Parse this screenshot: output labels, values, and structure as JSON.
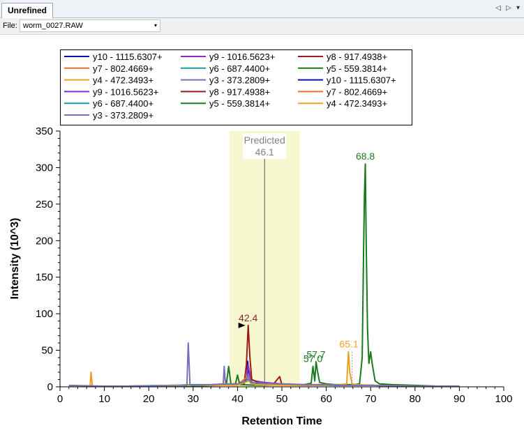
{
  "tab": {
    "label": "Unrefined"
  },
  "tab_controls": {
    "prev": "◁",
    "next": "▷",
    "menu": "▾"
  },
  "file": {
    "label": "File:",
    "value": "worm_0027.RAW",
    "dropdown_glyph": "▾"
  },
  "chart_data": {
    "type": "line",
    "xlabel": "Retention Time",
    "ylabel": "Intensity (10^3)",
    "xlim": [
      0,
      100
    ],
    "ylim": [
      0,
      350
    ],
    "xticks": [
      0,
      10,
      20,
      30,
      40,
      50,
      60,
      70,
      80,
      90,
      100
    ],
    "yticks": [
      0,
      50,
      100,
      150,
      200,
      250,
      300,
      350
    ],
    "legend_position": "top",
    "predicted": {
      "label": "Predicted",
      "value": "46.1",
      "x": 46.1,
      "window": [
        38.2,
        54.0
      ]
    },
    "series": [
      {
        "name": "y10 - 1115.6307+",
        "color": "#0a10a8",
        "points": [
          [
            2,
            1
          ],
          [
            10,
            1
          ],
          [
            20,
            1
          ],
          [
            30,
            2
          ],
          [
            38,
            3
          ],
          [
            41,
            3
          ],
          [
            42.1,
            12
          ],
          [
            42.3,
            35
          ],
          [
            42.6,
            14
          ],
          [
            43.2,
            6
          ],
          [
            45,
            4
          ],
          [
            50,
            3
          ],
          [
            55,
            2
          ],
          [
            60,
            2
          ],
          [
            65,
            2
          ],
          [
            70,
            2
          ],
          [
            80,
            1
          ],
          [
            90,
            1
          ]
        ]
      },
      {
        "name": "y9 - 1016.5623+",
        "color": "#8a2cc8",
        "points": [
          [
            2,
            1
          ],
          [
            15,
            1
          ],
          [
            25,
            2
          ],
          [
            35,
            2
          ],
          [
            40,
            3
          ],
          [
            42.0,
            8
          ],
          [
            42.4,
            30
          ],
          [
            43,
            10
          ],
          [
            44,
            8
          ],
          [
            46,
            6
          ],
          [
            48,
            5
          ],
          [
            50,
            4
          ],
          [
            55,
            3
          ],
          [
            60,
            3
          ],
          [
            65,
            2
          ],
          [
            70,
            2
          ],
          [
            80,
            1
          ],
          [
            90,
            1
          ]
        ]
      },
      {
        "name": "y8 - 917.4938+",
        "color": "#9e1a1a",
        "points": [
          [
            2,
            1
          ],
          [
            20,
            1
          ],
          [
            30,
            2
          ],
          [
            38,
            3
          ],
          [
            41.5,
            4
          ],
          [
            42.0,
            30
          ],
          [
            42.4,
            84
          ],
          [
            42.8,
            40
          ],
          [
            43.2,
            10
          ],
          [
            45,
            5
          ],
          [
            48,
            3
          ],
          [
            49.5,
            14
          ],
          [
            50,
            3
          ],
          [
            55,
            2
          ],
          [
            60,
            2
          ],
          [
            70,
            2
          ],
          [
            80,
            1
          ],
          [
            90,
            1
          ]
        ]
      },
      {
        "name": "y7 - 802.4669+",
        "color": "#e8742a",
        "points": [
          [
            2,
            1
          ],
          [
            20,
            1
          ],
          [
            30,
            2
          ],
          [
            40,
            3
          ],
          [
            42.3,
            14
          ],
          [
            43,
            5
          ],
          [
            50,
            3
          ],
          [
            60,
            2
          ],
          [
            65,
            3
          ],
          [
            70,
            2
          ],
          [
            80,
            1
          ],
          [
            90,
            1
          ]
        ]
      },
      {
        "name": "y6 - 687.4400+",
        "color": "#1a9aa0",
        "points": [
          [
            2,
            1
          ],
          [
            15,
            1
          ],
          [
            25,
            2
          ],
          [
            30,
            3
          ],
          [
            35,
            3
          ],
          [
            40,
            3
          ],
          [
            42.4,
            10
          ],
          [
            44,
            4
          ],
          [
            50,
            3
          ],
          [
            60,
            2
          ],
          [
            70,
            2
          ],
          [
            80,
            1
          ],
          [
            90,
            1
          ]
        ]
      },
      {
        "name": "y5 - 559.3814+",
        "color": "#1a7a1a",
        "points": [
          [
            2,
            1
          ],
          [
            20,
            1
          ],
          [
            30,
            1
          ],
          [
            36,
            2
          ],
          [
            37.5,
            4
          ],
          [
            38.0,
            28
          ],
          [
            38.5,
            4
          ],
          [
            39.5,
            3
          ],
          [
            40.0,
            16
          ],
          [
            40.5,
            3
          ],
          [
            45,
            2
          ],
          [
            52,
            3
          ],
          [
            55,
            3
          ],
          [
            56.6,
            5
          ],
          [
            57.0,
            28
          ],
          [
            57.4,
            8
          ],
          [
            57.7,
            34
          ],
          [
            58.0,
            22
          ],
          [
            58.5,
            6
          ],
          [
            60,
            4
          ],
          [
            62,
            3
          ],
          [
            64,
            3
          ],
          [
            66,
            3
          ],
          [
            67.5,
            4
          ],
          [
            68.1,
            40
          ],
          [
            68.4,
            180
          ],
          [
            68.6,
            262
          ],
          [
            68.8,
            305
          ],
          [
            69.0,
            200
          ],
          [
            69.3,
            80
          ],
          [
            69.6,
            32
          ],
          [
            70.0,
            48
          ],
          [
            70.4,
            30
          ],
          [
            71,
            8
          ],
          [
            72,
            4
          ],
          [
            75,
            3
          ],
          [
            80,
            2
          ],
          [
            85,
            1
          ],
          [
            90,
            1
          ]
        ]
      },
      {
        "name": "y4 - 472.3493+",
        "color": "#f0a020",
        "points": [
          [
            2,
            1
          ],
          [
            6.8,
            1
          ],
          [
            7.0,
            20
          ],
          [
            7.3,
            1
          ],
          [
            10,
            1
          ],
          [
            20,
            1
          ],
          [
            30,
            2
          ],
          [
            40,
            2
          ],
          [
            42.4,
            8
          ],
          [
            44,
            3
          ],
          [
            50,
            2
          ],
          [
            60,
            2
          ],
          [
            63,
            3
          ],
          [
            64.6,
            4
          ],
          [
            65.0,
            48
          ],
          [
            65.3,
            20
          ],
          [
            65.8,
            4
          ],
          [
            67,
            3
          ],
          [
            70,
            2
          ],
          [
            80,
            1
          ],
          [
            90,
            1
          ]
        ]
      },
      {
        "name": "y3 - 373.2809+",
        "color": "#7a70b8",
        "points": [
          [
            2,
            2
          ],
          [
            10,
            1
          ],
          [
            20,
            1
          ],
          [
            27,
            1
          ],
          [
            28.6,
            2
          ],
          [
            28.9,
            60
          ],
          [
            29.3,
            3
          ],
          [
            30,
            2
          ],
          [
            34,
            3
          ],
          [
            36.8,
            4
          ],
          [
            37.0,
            28
          ],
          [
            37.3,
            4
          ],
          [
            40,
            4
          ],
          [
            42.0,
            8
          ],
          [
            42.4,
            18
          ],
          [
            43,
            6
          ],
          [
            45,
            5
          ],
          [
            50,
            4
          ],
          [
            55,
            3
          ],
          [
            60,
            3
          ],
          [
            65,
            2
          ],
          [
            70,
            2
          ],
          [
            80,
            1
          ],
          [
            90,
            1
          ]
        ]
      }
    ],
    "annotations": [
      {
        "text": "42.4",
        "x": 42.4,
        "y": 84,
        "color": "#8a2030"
      },
      {
        "text": "57.0",
        "x": 57.0,
        "y": 28,
        "color": "#1a7a1a"
      },
      {
        "text": "57.7",
        "x": 57.7,
        "y": 34,
        "color": "#1a7a1a"
      },
      {
        "text": "65.1",
        "x": 65.1,
        "y": 48,
        "color": "#f0a020"
      },
      {
        "text": "68.8",
        "x": 68.8,
        "y": 305,
        "color": "#1a7a1a"
      }
    ]
  }
}
